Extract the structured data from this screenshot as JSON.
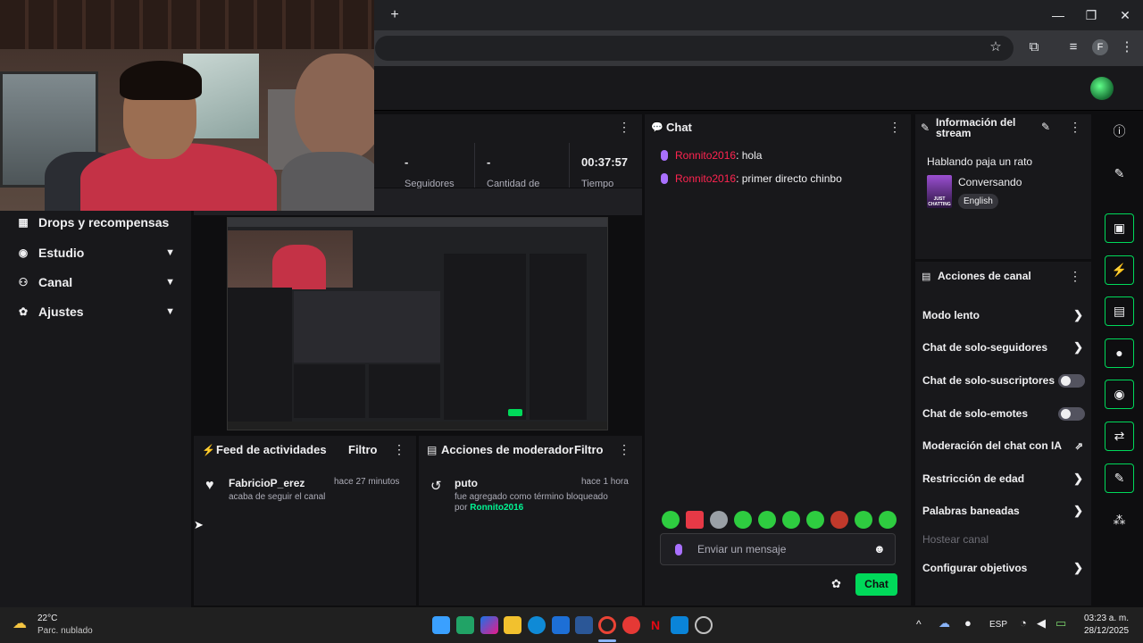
{
  "browser": {
    "new_tab": "+",
    "minimize": "—",
    "maximize": "❐",
    "close": "✕",
    "profile_initial": "F"
  },
  "sidebar": {
    "items": [
      {
        "label": "Drops y recompensas",
        "icon": "gift-icon",
        "expandable": false
      },
      {
        "label": "Estudio",
        "icon": "studio-icon",
        "expandable": true
      },
      {
        "label": "Canal",
        "icon": "channel-icon",
        "expandable": true
      },
      {
        "label": "Ajustes",
        "icon": "gear-icon",
        "expandable": true
      }
    ]
  },
  "stats": {
    "values": [
      "-",
      "-",
      "00:37:57"
    ],
    "labels": [
      "Seguidores",
      "Cantidad de",
      "Tiempo"
    ]
  },
  "activity_feed": {
    "title": "Feed de actividades",
    "filter": "Filtro",
    "item": {
      "user": "FabricioP_erez",
      "time": "hace 27 minutos",
      "text": "acaba de seguir el canal"
    }
  },
  "mod_actions": {
    "title": "Acciones de moderador",
    "filter": "Filtro",
    "item": {
      "user": "puto",
      "time": "hace 1 hora",
      "text": "fue agregado como término bloqueado",
      "by_prefix": "por",
      "by_user": "Ronnito2016"
    }
  },
  "chat": {
    "title": "Chat",
    "messages": [
      {
        "user": "Ronnito2016",
        "text": ": hola"
      },
      {
        "user": "Ronnito2016",
        "text": ": primer directo chinbo"
      }
    ],
    "input_placeholder": "Enviar un mensaje",
    "send_label": "Chat"
  },
  "stream_info": {
    "title": "Información del stream",
    "stream_title": "Hablando paja un rato",
    "category": "Conversando",
    "language": "English",
    "thumb_text": "JUST CHATTING"
  },
  "channel_actions": {
    "title": "Acciones de canal",
    "rows": [
      {
        "label": "Modo lento",
        "control": "chevron"
      },
      {
        "label": "Chat de solo-seguidores",
        "control": "chevron"
      },
      {
        "label": "Chat de solo-suscriptores",
        "control": "toggle"
      },
      {
        "label": "Chat de solo-emotes",
        "control": "toggle"
      },
      {
        "label": "Moderación del chat con IA",
        "control": "external"
      },
      {
        "label": "Restricción de edad",
        "control": "chevron"
      },
      {
        "label": "Palabras baneadas",
        "control": "chevron"
      },
      {
        "label": "Hostear canal",
        "control": "disabled"
      },
      {
        "label": "Configurar objetivos",
        "control": "chevron"
      }
    ]
  },
  "taskbar": {
    "weather_temp": "22°C",
    "weather_desc": "Parc. nublado",
    "lang": "ESP",
    "time": "03:23 a. m.",
    "date": "28/12/2025"
  },
  "colors": {
    "accent_green": "#00d95a",
    "username_red": "#ff2450",
    "mod_green": "#00f593",
    "mic_purple": "#a970ff"
  }
}
